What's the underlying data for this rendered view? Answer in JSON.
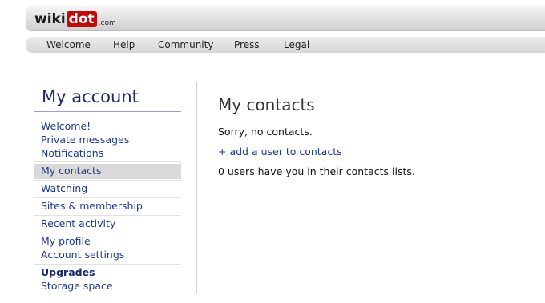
{
  "logo": {
    "wiki": "wiki",
    "dot": "dot",
    "com": ".com"
  },
  "topnav": {
    "items": [
      "Welcome",
      "Help",
      "Community",
      "Press",
      "Legal"
    ]
  },
  "sidebar": {
    "title": "My account",
    "items": [
      {
        "label": "Welcome!"
      },
      {
        "label": "Private messages"
      },
      {
        "label": "Notifications"
      },
      {
        "label": "My contacts",
        "selected": true
      },
      {
        "label": "Watching"
      },
      {
        "label": "Sites & membership"
      },
      {
        "label": "Recent activity"
      },
      {
        "label": "My profile"
      },
      {
        "label": "Account settings"
      },
      {
        "label": "Upgrades",
        "bold": true
      },
      {
        "label": "Storage space"
      }
    ]
  },
  "main": {
    "title": "My contacts",
    "no_contacts": "Sorry, no contacts.",
    "add_link": "+ add a user to contacts",
    "reverse_count": "0 users have you in their contacts lists."
  },
  "colors": {
    "link": "#1d3a8a",
    "logo_red": "#c00b0b",
    "selected_bg": "#d9d9d9",
    "title_navy": "#1b2a66"
  }
}
